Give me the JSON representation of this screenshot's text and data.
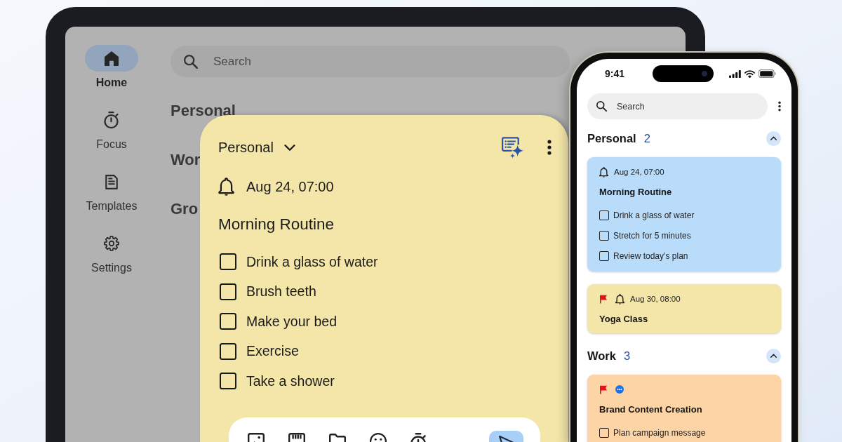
{
  "tablet": {
    "nav_rail": [
      {
        "label": "Home",
        "selected": true
      },
      {
        "label": "Focus",
        "selected": false
      },
      {
        "label": "Templates",
        "selected": false
      },
      {
        "label": "Settings",
        "selected": false
      }
    ],
    "search": {
      "placeholder": "Search"
    },
    "sections": [
      {
        "title": "Personal"
      },
      {
        "title": "Wor"
      },
      {
        "title": "Gro"
      }
    ]
  },
  "note_editor": {
    "category": "Personal",
    "reminder": "Aug 24, 07:00",
    "title": "Morning Routine",
    "checklist": [
      {
        "text": "Drink a glass of water",
        "checked": false
      },
      {
        "text": "Brush teeth",
        "checked": false
      },
      {
        "text": "Make your bed",
        "checked": false
      },
      {
        "text": "Exercise",
        "checked": false
      },
      {
        "text": "Take a shower",
        "checked": false
      }
    ]
  },
  "phone": {
    "status_bar": {
      "time": "9:41"
    },
    "search": {
      "placeholder": "Search"
    },
    "groups": [
      {
        "name": "Personal",
        "count": "2",
        "expanded": true,
        "notes": [
          {
            "color": "#b9dcfb",
            "flagged": false,
            "pending": false,
            "reminder": "Aug 24, 07:00",
            "title": "Morning Routine",
            "checklist": [
              {
                "text": "Drink a glass of water",
                "checked": false
              },
              {
                "text": "Stretch for 5 minutes",
                "checked": false
              },
              {
                "text": "Review today’s plan",
                "checked": false
              }
            ]
          },
          {
            "color": "#f3e6a8",
            "flagged": true,
            "pending": false,
            "reminder": "Aug 30, 08:00",
            "title": "Yoga Class"
          }
        ]
      },
      {
        "name": "Work",
        "count": "3",
        "expanded": true,
        "notes": [
          {
            "color": "#fdd4a6",
            "flagged": true,
            "pending": true,
            "title": "Brand Content Creation",
            "checklist": [
              {
                "text": "Plan campaign message",
                "checked": false
              }
            ]
          }
        ]
      }
    ]
  }
}
